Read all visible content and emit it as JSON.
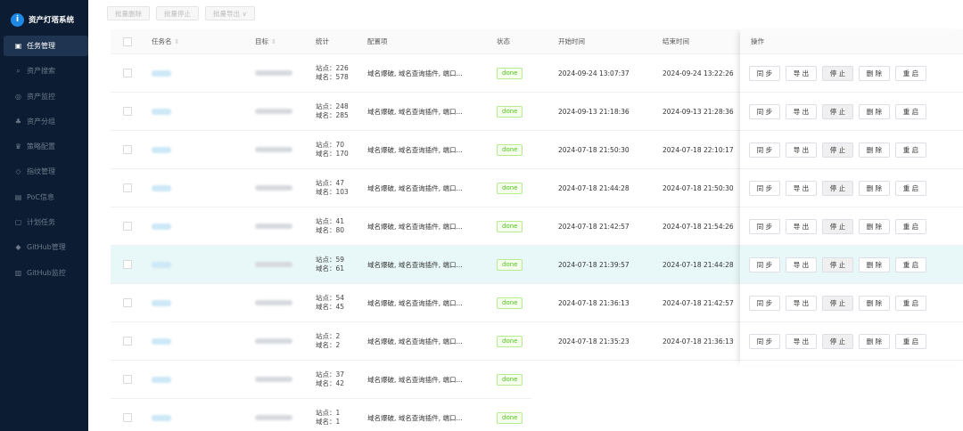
{
  "sidebar": {
    "logo_mark": "i",
    "logo_text": "资产灯塔系统",
    "items": [
      {
        "label": "任务管理",
        "icon": "▣"
      },
      {
        "label": "资产搜索",
        "icon": "⌕"
      },
      {
        "label": "资产监控",
        "icon": "◎"
      },
      {
        "label": "资产分组",
        "icon": "♣"
      },
      {
        "label": "策略配置",
        "icon": "♛"
      },
      {
        "label": "指纹管理",
        "icon": "◇"
      },
      {
        "label": "PoC信息",
        "icon": "▤"
      },
      {
        "label": "计划任务",
        "icon": "▢"
      },
      {
        "label": "GitHub管理",
        "icon": "◆"
      },
      {
        "label": "GitHub监控",
        "icon": "▥"
      }
    ]
  },
  "toolbar": {
    "batch_delete": "批量删除",
    "batch_stop": "批量停止",
    "batch_export": "批量导出 ∨"
  },
  "table": {
    "headers": {
      "name": "任务名",
      "target": "目标",
      "stats": "统计",
      "config": "配置项",
      "status": "状态",
      "start": "开始时间",
      "end": "结束时间",
      "ops": "操作"
    },
    "sort_icon": "⇕",
    "rows": [
      {
        "site": "站点：226",
        "domain": "域名：578",
        "config": "域名爆破, 域名查询插件, 端口...",
        "status": "done",
        "start": "2024-09-24 13:07:37",
        "end": "2024-09-24 13:22:26"
      },
      {
        "site": "站点：248",
        "domain": "域名：285",
        "config": "域名爆破, 域名查询插件, 端口...",
        "status": "done",
        "start": "2024-09-13 21:18:36",
        "end": "2024-09-13 21:28:36"
      },
      {
        "site": "站点：70",
        "domain": "域名：170",
        "config": "域名爆破, 域名查询插件, 端口...",
        "status": "done",
        "start": "2024-07-18 21:50:30",
        "end": "2024-07-18 22:10:17"
      },
      {
        "site": "站点：47",
        "domain": "域名：103",
        "config": "域名爆破, 域名查询插件, 端口...",
        "status": "done",
        "start": "2024-07-18 21:44:28",
        "end": "2024-07-18 21:50:30"
      },
      {
        "site": "站点：41",
        "domain": "域名：80",
        "config": "域名爆破, 域名查询插件, 端口...",
        "status": "done",
        "start": "2024-07-18 21:42:57",
        "end": "2024-07-18 21:54:26"
      },
      {
        "site": "站点：59",
        "domain": "域名：61",
        "config": "域名爆破, 域名查询插件, 端口...",
        "status": "done",
        "start": "2024-07-18 21:39:57",
        "end": "2024-07-18 21:44:28"
      },
      {
        "site": "站点：54",
        "domain": "域名：45",
        "config": "域名爆破, 域名查询插件, 端口...",
        "status": "done",
        "start": "2024-07-18 21:36:13",
        "end": "2024-07-18 21:42:57"
      },
      {
        "site": "站点：2",
        "domain": "域名：2",
        "config": "域名爆破, 域名查询插件, 端口...",
        "status": "done",
        "start": "2024-07-18 21:35:23",
        "end": "2024-07-18 21:36:13"
      },
      {
        "site": "站点：37",
        "domain": "域名：42",
        "config": "域名爆破, 域名查询插件, 端口...",
        "status": "done",
        "start": "",
        "end": ""
      },
      {
        "site": "站点：1",
        "domain": "域名：1",
        "config": "域名爆破, 域名查询插件, 端口...",
        "status": "done",
        "start": "",
        "end": ""
      }
    ]
  },
  "ops": {
    "sync": "同 步",
    "export": "导 出",
    "stop": "停 止",
    "delete": "删 除",
    "restart": "重 启"
  }
}
